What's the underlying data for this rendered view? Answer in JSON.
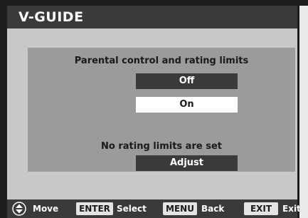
{
  "title": "V-GUIDE",
  "menu": {
    "heading": "Parental control and rating limits",
    "options": [
      "Off",
      "On"
    ],
    "selected": "On",
    "status": "No rating limits are set",
    "adjust_label": "Adjust"
  },
  "footer": {
    "move_label": "Move",
    "enter_key": "ENTER",
    "enter_label": "Select",
    "menu_key": "MENU",
    "menu_label": "Back",
    "exit_key": "EXIT",
    "exit_label": "Exit"
  },
  "icons": {
    "nav": "up-down-navigation-icon"
  },
  "colors": {
    "background": "#1e1e1e",
    "title_bar": "#3a3a3a",
    "content": "#c8c8c8",
    "panel": "#9b9b9b",
    "highlight": "#ffffff",
    "key_cap": "#e4e4e4"
  }
}
